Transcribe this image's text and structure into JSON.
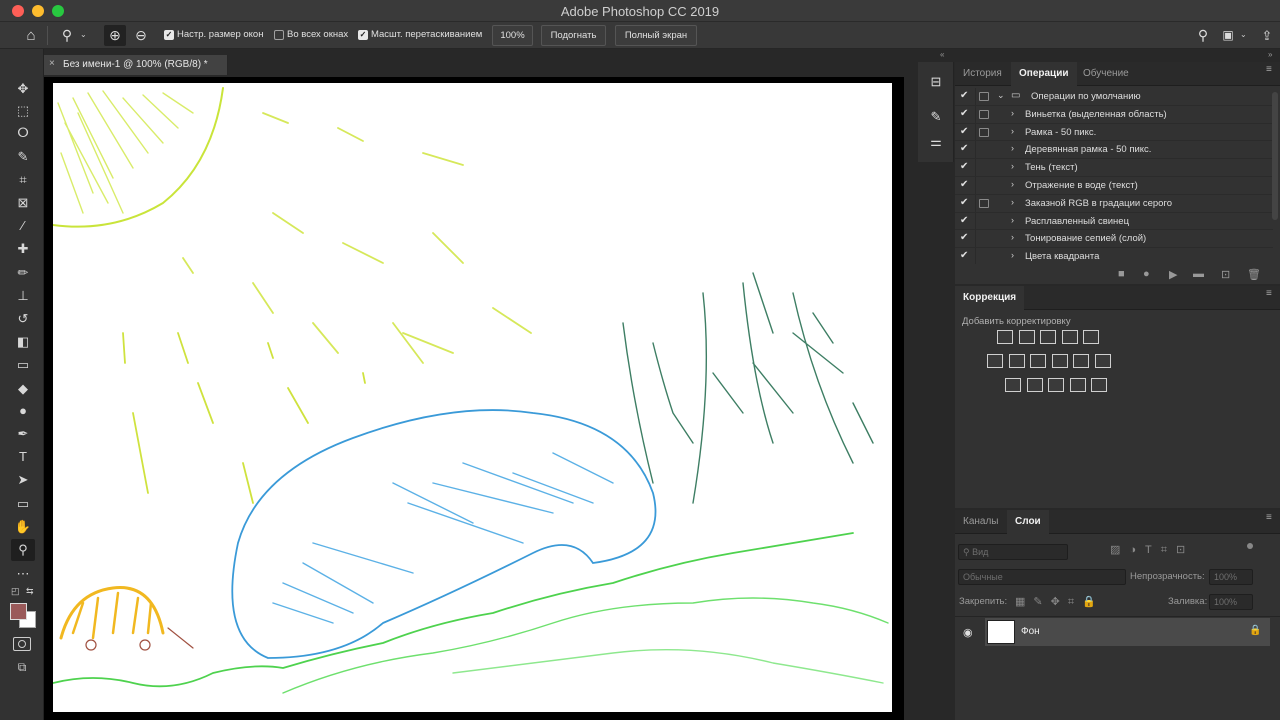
{
  "window": {
    "title": "Adobe Photoshop CC 2019",
    "traffic": [
      "close",
      "minimize",
      "zoom"
    ]
  },
  "options_bar": {
    "home_icon": "home-icon",
    "zoom_tool_icon": "zoom-tool-icon",
    "zoom_in_icon": "zoom-in-icon",
    "zoom_out_icon": "zoom-out-icon",
    "resize_windows": {
      "label": "Настр. размер окон",
      "checked": true
    },
    "all_windows": {
      "label": "Во всех окнах",
      "checked": false
    },
    "scrubby_zoom": {
      "label": "Масшт. перетаскиванием",
      "checked": true
    },
    "zoom_value": "100%",
    "fit_button": "Подогнать",
    "fullscreen_button": "Полный экран",
    "right_icons": [
      "search-icon",
      "workspace-icon",
      "share-icon"
    ]
  },
  "tools": [
    {
      "name": "move-tool",
      "glyph": "✥"
    },
    {
      "name": "marquee-tool",
      "glyph": "⬚"
    },
    {
      "name": "lasso-tool",
      "glyph": "ⵔ"
    },
    {
      "name": "quick-selection-tool",
      "glyph": "✎"
    },
    {
      "name": "crop-tool",
      "glyph": "⌗"
    },
    {
      "name": "frame-tool",
      "glyph": "⊠"
    },
    {
      "name": "eyedropper-tool",
      "glyph": "⁄"
    },
    {
      "name": "healing-brush-tool",
      "glyph": "✚"
    },
    {
      "name": "brush-tool",
      "glyph": "✏"
    },
    {
      "name": "clone-stamp-tool",
      "glyph": "⊥"
    },
    {
      "name": "history-brush-tool",
      "glyph": "↺"
    },
    {
      "name": "eraser-tool",
      "glyph": "◧"
    },
    {
      "name": "gradient-tool",
      "glyph": "▭"
    },
    {
      "name": "blur-tool",
      "glyph": "◆"
    },
    {
      "name": "dodge-tool",
      "glyph": "●"
    },
    {
      "name": "pen-tool",
      "glyph": "✒"
    },
    {
      "name": "type-tool",
      "glyph": "T"
    },
    {
      "name": "path-selection-tool",
      "glyph": "➤"
    },
    {
      "name": "rectangle-tool",
      "glyph": "▭"
    },
    {
      "name": "hand-tool",
      "glyph": "✋"
    },
    {
      "name": "zoom-tool",
      "glyph": "⚲"
    },
    {
      "name": "more-tools",
      "glyph": "⋯"
    }
  ],
  "colors": {
    "foreground": "#9a5a5a",
    "background": "#ffffff",
    "app_bg": "#282828",
    "panel_bg": "#323232"
  },
  "document": {
    "tab_title": "Без имени-1 @ 100% (RGB/8) *",
    "close_glyph": "×"
  },
  "actions_panel": {
    "tabs": [
      "История",
      "Операции",
      "Обучение"
    ],
    "active_tab": "Операции",
    "set_name": "Операции по умолчанию",
    "actions": [
      {
        "label": "Виньетка (выделенная область)",
        "dialog": true
      },
      {
        "label": "Рамка - 50 пикс.",
        "dialog": true
      },
      {
        "label": "Деревянная рамка - 50 пикс.",
        "dialog": false
      },
      {
        "label": "Тень (текст)",
        "dialog": false
      },
      {
        "label": "Отражение в воде (текст)",
        "dialog": false
      },
      {
        "label": "Заказной RGB в градации серого",
        "dialog": true
      },
      {
        "label": "Расплавленный свинец",
        "dialog": false
      },
      {
        "label": "Тонирование сепией (слой)",
        "dialog": false
      },
      {
        "label": "Цвета квадранта",
        "dialog": false
      }
    ],
    "buttons": [
      "stop-icon",
      "record-icon",
      "play-icon",
      "folder-icon",
      "new-action-icon",
      "trash-icon"
    ]
  },
  "adjustments_panel": {
    "title": "Коррекция",
    "subtitle": "Добавить корректировку",
    "rows": [
      [
        "brightness-icon",
        "levels-icon",
        "curves-icon",
        "exposure-icon",
        "vibrance-icon"
      ],
      [
        "hue-saturation-icon",
        "color-balance-icon",
        "black-white-icon",
        "photo-filter-icon",
        "channel-mixer-icon",
        "color-lookup-icon"
      ],
      [
        "invert-icon",
        "posterize-icon",
        "threshold-icon",
        "selective-color-icon",
        "gradient-map-icon"
      ]
    ]
  },
  "layers_panel": {
    "tabs": [
      "Каналы",
      "Слои"
    ],
    "active_tab": "Слои",
    "filter_placeholder": "Вид",
    "blend_mode": "Обычные",
    "opacity_label": "Непрозрачность:",
    "opacity_value": "100%",
    "lock_label": "Закрепить:",
    "fill_label": "Заливка:",
    "fill_value": "100%",
    "layers": [
      {
        "name": "Фон",
        "visible": true,
        "locked": true
      }
    ]
  }
}
